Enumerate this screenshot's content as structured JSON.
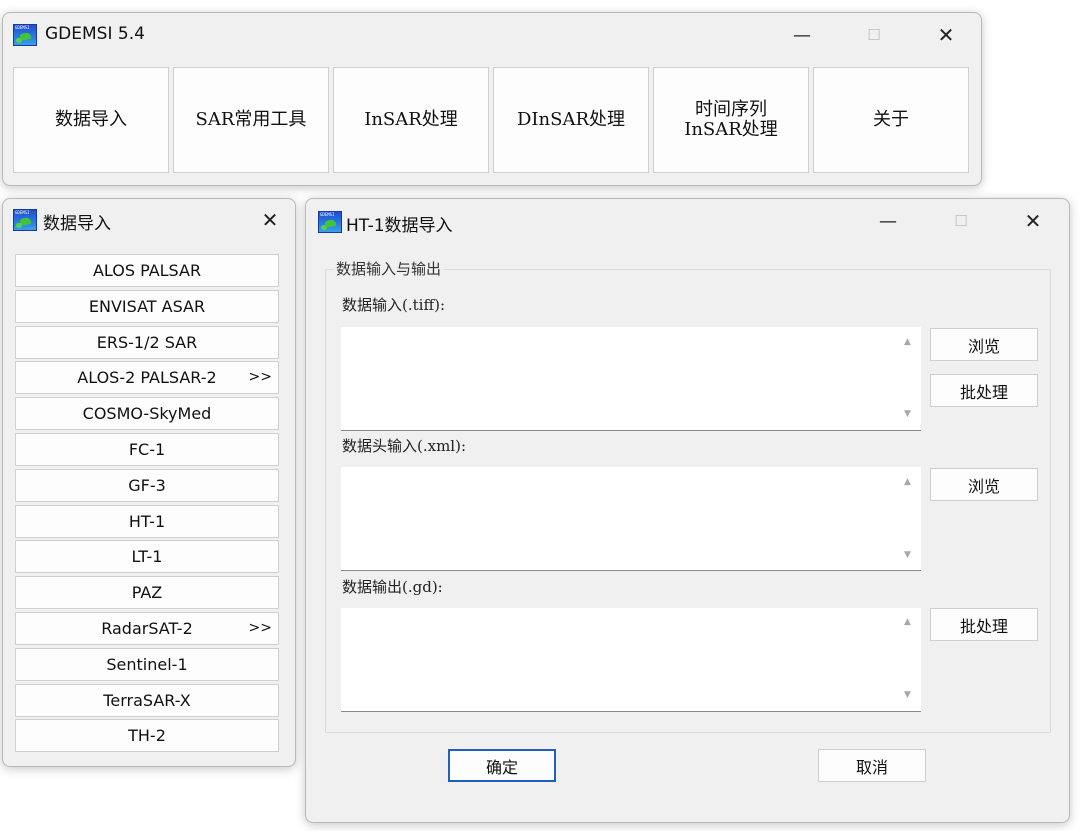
{
  "main_window": {
    "title": "GDEMSI 5.4",
    "icon_label": "GDEMSI",
    "buttons": [
      {
        "label": "数据导入"
      },
      {
        "label": "SAR常用工具"
      },
      {
        "label": "InSAR处理"
      },
      {
        "label": "DInSAR处理"
      },
      {
        "label": "时间序列\nInSAR处理"
      },
      {
        "label": "关于"
      }
    ]
  },
  "import_window": {
    "title": "数据导入",
    "items": [
      {
        "label": "ALOS PALSAR",
        "more": ""
      },
      {
        "label": "ENVISAT ASAR",
        "more": ""
      },
      {
        "label": "ERS-1/2 SAR",
        "more": ""
      },
      {
        "label": "ALOS-2 PALSAR-2",
        "more": ">>"
      },
      {
        "label": "COSMO-SkyMed",
        "more": ""
      },
      {
        "label": "FC-1",
        "more": ""
      },
      {
        "label": "GF-3",
        "more": ""
      },
      {
        "label": "HT-1",
        "more": ""
      },
      {
        "label": "LT-1",
        "more": ""
      },
      {
        "label": "PAZ",
        "more": ""
      },
      {
        "label": "RadarSAT-2",
        "more": ">>"
      },
      {
        "label": "Sentinel-1",
        "more": ""
      },
      {
        "label": "TerraSAR-X",
        "more": ""
      },
      {
        "label": "TH-2",
        "more": ""
      }
    ]
  },
  "ht1_dialog": {
    "title": "HT-1数据导入",
    "group_title": "数据输入与输出",
    "fields": [
      {
        "label": "数据输入(.tiff):",
        "value": "",
        "buttons": [
          "浏览",
          "批处理"
        ]
      },
      {
        "label": "数据头输入(.xml):",
        "value": "",
        "buttons": [
          "浏览"
        ]
      },
      {
        "label": "数据输出(.gd):",
        "value": "",
        "buttons": [
          "批处理"
        ]
      }
    ],
    "ok_label": "确定",
    "cancel_label": "取消"
  },
  "window_controls": {
    "minimize": "—",
    "maximize": "☐",
    "close": "✕"
  },
  "colors": {
    "window_bg": "#f0f0f0",
    "button_bg": "#fdfdfd",
    "default_button_border": "#1f5fbf"
  }
}
